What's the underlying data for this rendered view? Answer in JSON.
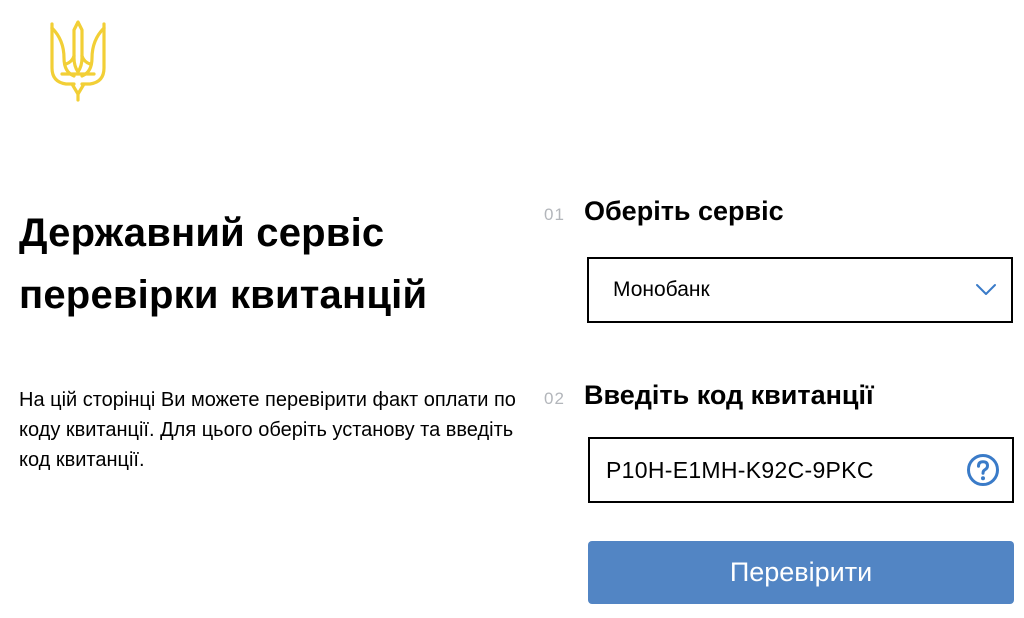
{
  "header": {
    "logo_icon": "ukraine-trident-icon",
    "logo_color": "#F2CF36"
  },
  "intro": {
    "title_line1": "Державний сервіс",
    "title_line2": "перевірки квитанцій",
    "description": "На цій сторінці Ви можете перевірити факт оплати по коду квитанції. Для цього оберіть установу та введіть код квитанції."
  },
  "form": {
    "step1": {
      "number": "01",
      "title": "Оберіть сервіс",
      "selected_value": "Монобанк",
      "dropdown_icon": "chevron-down-icon"
    },
    "step2": {
      "number": "02",
      "title": "Введіть код квитанції",
      "code_value": "P10H-E1MH-K92C-9PKC",
      "help_icon": "question-circle-icon"
    },
    "submit_label": "Перевірити"
  },
  "colors": {
    "accent": "#3A7BC8",
    "button_bg": "#5285C4",
    "step_number": "#B3B6BB"
  }
}
